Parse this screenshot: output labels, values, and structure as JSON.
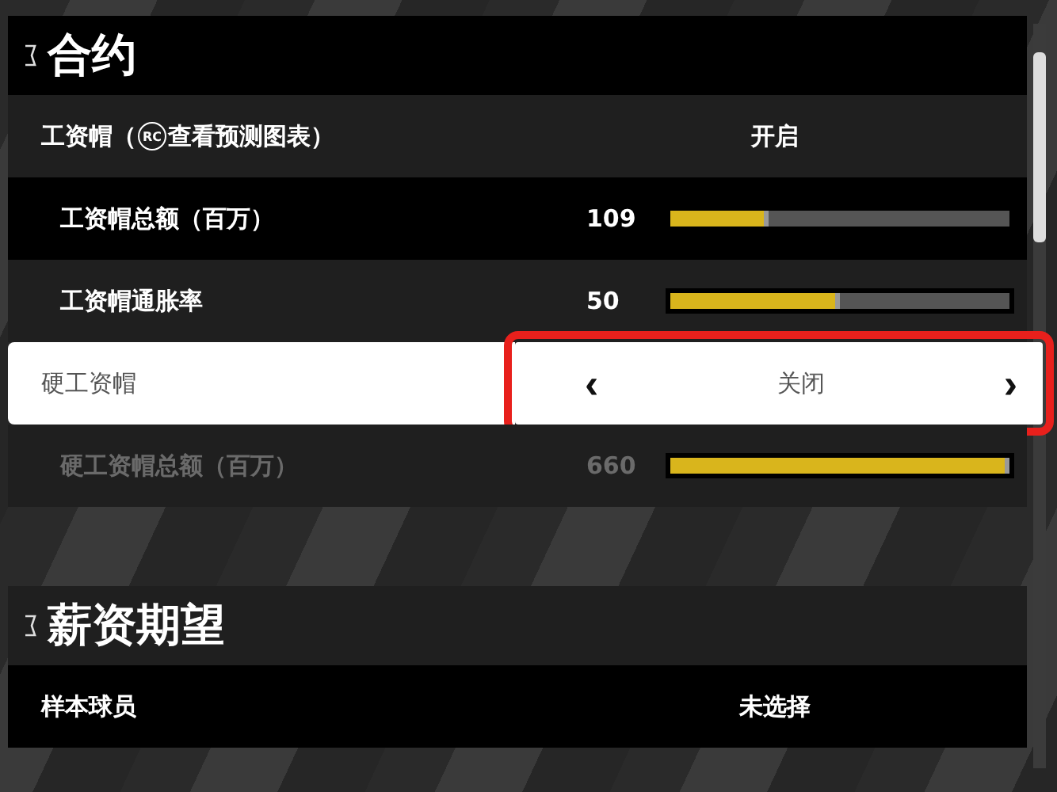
{
  "sections": [
    {
      "title": "合约",
      "rows": [
        {
          "kind": "toggle",
          "label": "工资帽（",
          "button_glyph": "RC",
          "label_suffix": "查看预测图表）",
          "value": "开启",
          "selected": false,
          "disabled": false,
          "children": [
            {
              "kind": "slider",
              "label": "工资帽总额（百万）",
              "value": "109",
              "level": 0.29,
              "selected": false,
              "disabled": false
            },
            {
              "kind": "slider",
              "label": "工资帽通胀率",
              "value": "50",
              "level": 0.5,
              "selected": false,
              "disabled": false
            }
          ]
        },
        {
          "kind": "toggle",
          "label": "硬工资帽",
          "value": "关闭",
          "selected": true,
          "disabled": false,
          "arrows": [
            "‹",
            "›"
          ],
          "children": [
            {
              "kind": "slider",
              "label": "硬工资帽总额（百万）",
              "value": "660",
              "level": 1.0,
              "selected": false,
              "disabled": true
            }
          ]
        }
      ]
    },
    {
      "title": "薪资期望",
      "rows": [
        {
          "kind": "toggle",
          "label": "样本球员",
          "value": "未选择",
          "selected": false,
          "disabled": false
        }
      ]
    }
  ]
}
